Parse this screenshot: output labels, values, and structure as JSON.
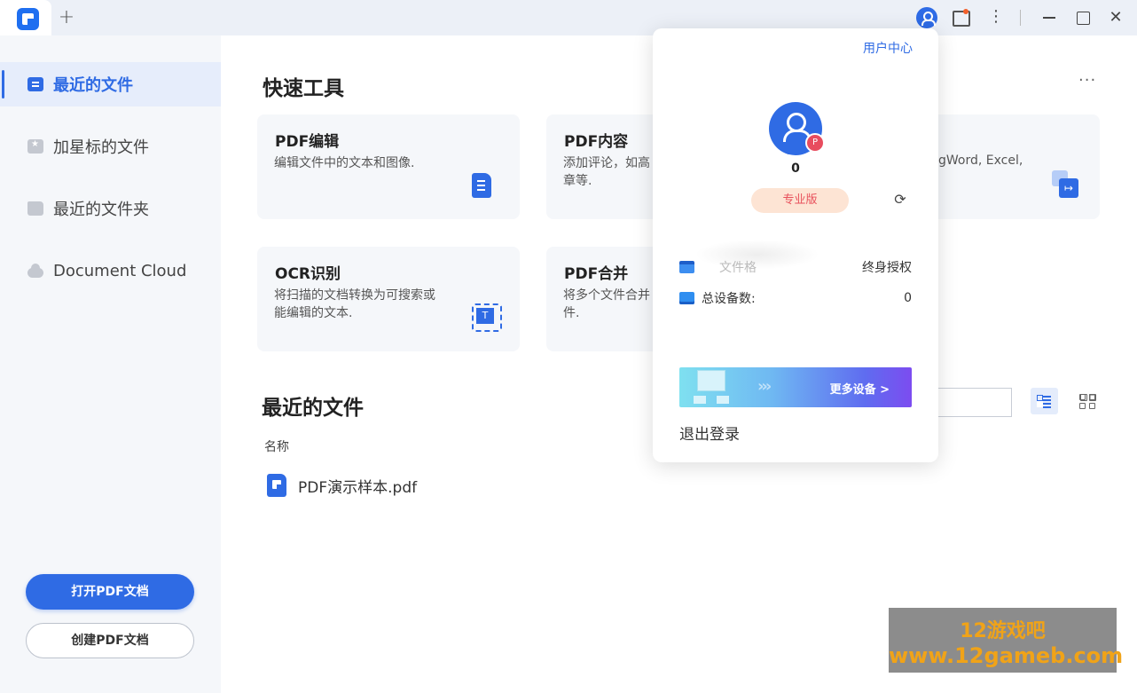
{
  "titlebar": {
    "new_tab": "+",
    "close": "✕",
    "kebab": "⋮"
  },
  "sidebar": {
    "items": [
      {
        "label": "最近的文件",
        "icon": "document-icon",
        "active": true
      },
      {
        "label": "加星标的文件",
        "icon": "star-file-icon",
        "active": false
      },
      {
        "label": "最近的文件夹",
        "icon": "folder-icon",
        "active": false
      },
      {
        "label": "Document Cloud",
        "icon": "cloud-icon",
        "active": false
      }
    ],
    "open_pdf": "打开PDF文档",
    "create_pdf": "创建PDF文档"
  },
  "quick_tools": {
    "title": "快速工具",
    "more": "···",
    "cards": [
      {
        "title": "PDF编辑",
        "desc": "编辑文件中的文本和图像."
      },
      {
        "title": "PDF内容",
        "desc": "添加评论，如高\n章等."
      },
      {
        "title": "OCR识别",
        "desc": "将扫描的文档转换为可搜索或\n能编辑的文本."
      },
      {
        "title": "PDF合并",
        "desc": "将多个文件合并\n件."
      }
    ],
    "partial_text": "gWord, Excel,"
  },
  "recent": {
    "title": "最近的文件",
    "column_name": "名称",
    "files": [
      {
        "name": "PDF演示样本.pdf"
      }
    ]
  },
  "popup": {
    "user_center": "用户中心",
    "count": "0",
    "edition": "专业版",
    "license_label": "文件格",
    "license_value": "终身授权",
    "devices_label": "总设备数:",
    "devices_value": "0",
    "banner_text": "更多设备 >",
    "logout": "退出登录"
  },
  "watermark": {
    "line1": "12游戏吧",
    "line2": "www.12gameb.com"
  },
  "colors": {
    "accent": "#2f6be4",
    "pro_text": "#e8505b",
    "pro_bg": "#fde4d4",
    "watermark_text": "#f0a318"
  }
}
